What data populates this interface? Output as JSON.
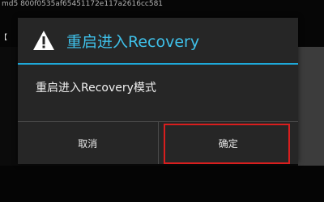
{
  "background": {
    "header_text": "md5 800f0535af65451172e117a2616cc581",
    "left_item_text": "【"
  },
  "dialog": {
    "icon": "warning-icon",
    "title": "重启进入Recovery",
    "message": "重启进入Recovery模式",
    "buttons": {
      "cancel_label": "取消",
      "confirm_label": "确定"
    }
  },
  "colors": {
    "accent": "#3fc1ea",
    "divider": "#1ea9d9",
    "highlight": "#d81e1e",
    "dialog_bg": "#262626"
  }
}
